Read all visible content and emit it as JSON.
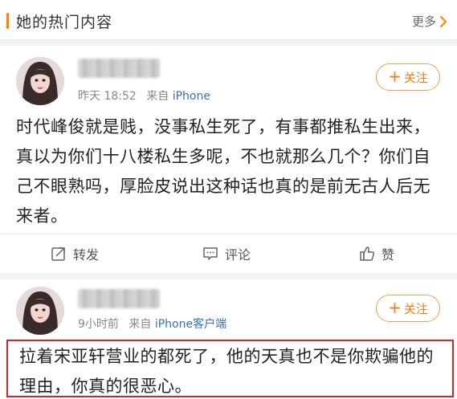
{
  "section": {
    "title": "她的热门内容",
    "more_label": "更多"
  },
  "colors": {
    "accent": "#ff8200",
    "follow": "#f07f1a",
    "device_link": "#3a6fb8",
    "highlight": "#d3262a"
  },
  "posts": [
    {
      "time": "昨天 18:52",
      "source_prefix": "来自",
      "device": "iPhone",
      "follow_label": "关注",
      "content": "时代峰俊就是贱，没事私生死了，有事都推私生出来，真以为你们十八楼私生多呢，不也就那么几个？你们自己不眼熟吗，厚脸皮说出这种话也真的是前无古人后无来者。",
      "actions": {
        "repost": "转发",
        "comment": "评论",
        "like": "赞"
      }
    },
    {
      "time": "9小时前",
      "source_prefix": "来自",
      "device": "iPhone客户端",
      "follow_label": "关注",
      "content": "拉着宋亚轩营业的都死了，他的天真也不是你欺骗他的理由，你真的很恶心。"
    }
  ],
  "icons": {
    "more": "chevron-right-icon",
    "follow": "plus-icon",
    "repost": "repost-icon",
    "comment": "comment-icon",
    "like": "thumbs-up-icon"
  }
}
